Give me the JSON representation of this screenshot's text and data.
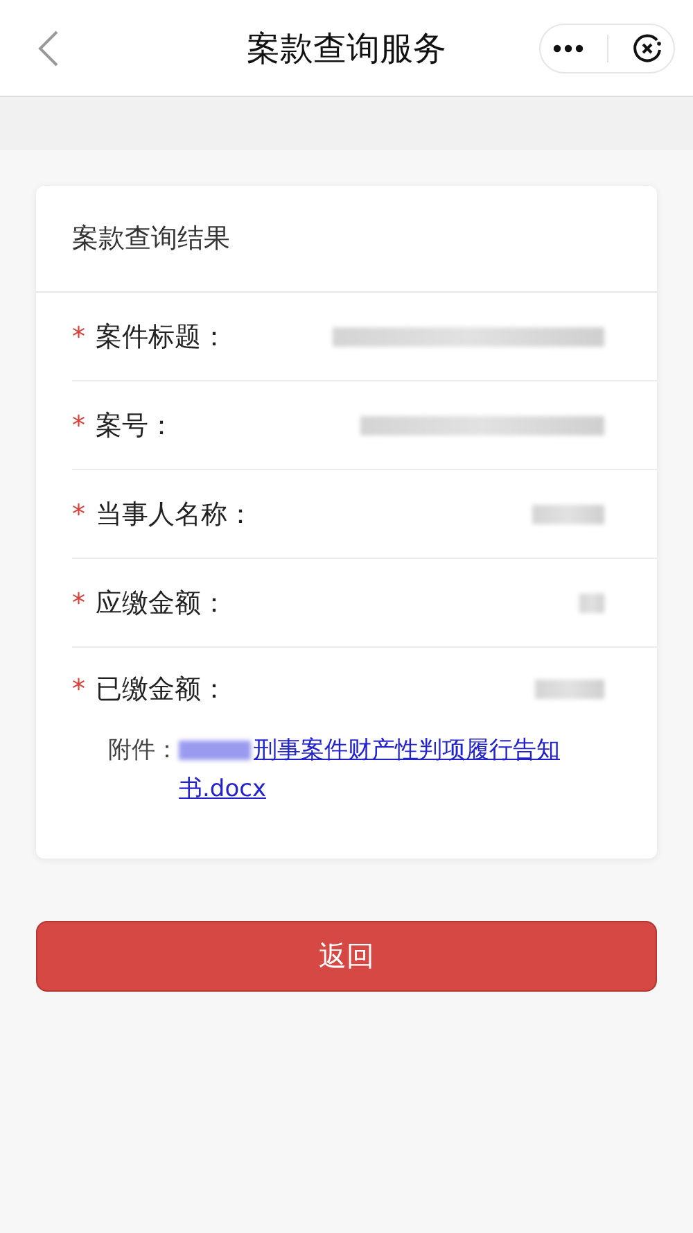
{
  "nav_bar": {
    "title": "案款查询服务"
  },
  "card": {
    "title": "案款查询结果",
    "fields": [
      {
        "label": "案件标题：",
        "required": true,
        "value": {
          "kind": "redacted"
        }
      },
      {
        "label": "案号：",
        "required": true,
        "value": {
          "kind": "redacted"
        }
      },
      {
        "label": "当事人名称：",
        "required": true,
        "value": {
          "kind": "redacted"
        }
      },
      {
        "label": "应缴金额：",
        "required": true,
        "value": {
          "kind": "redacted"
        }
      },
      {
        "label": "已缴金额：",
        "required": true,
        "value": {
          "kind": "redacted"
        }
      }
    ],
    "required_mark": "*",
    "attachment": {
      "label": "附件：",
      "link": "刑事案件财产性判项履行告知书.docx"
    }
  },
  "buttons": [
    {
      "label": "返回"
    }
  ]
}
